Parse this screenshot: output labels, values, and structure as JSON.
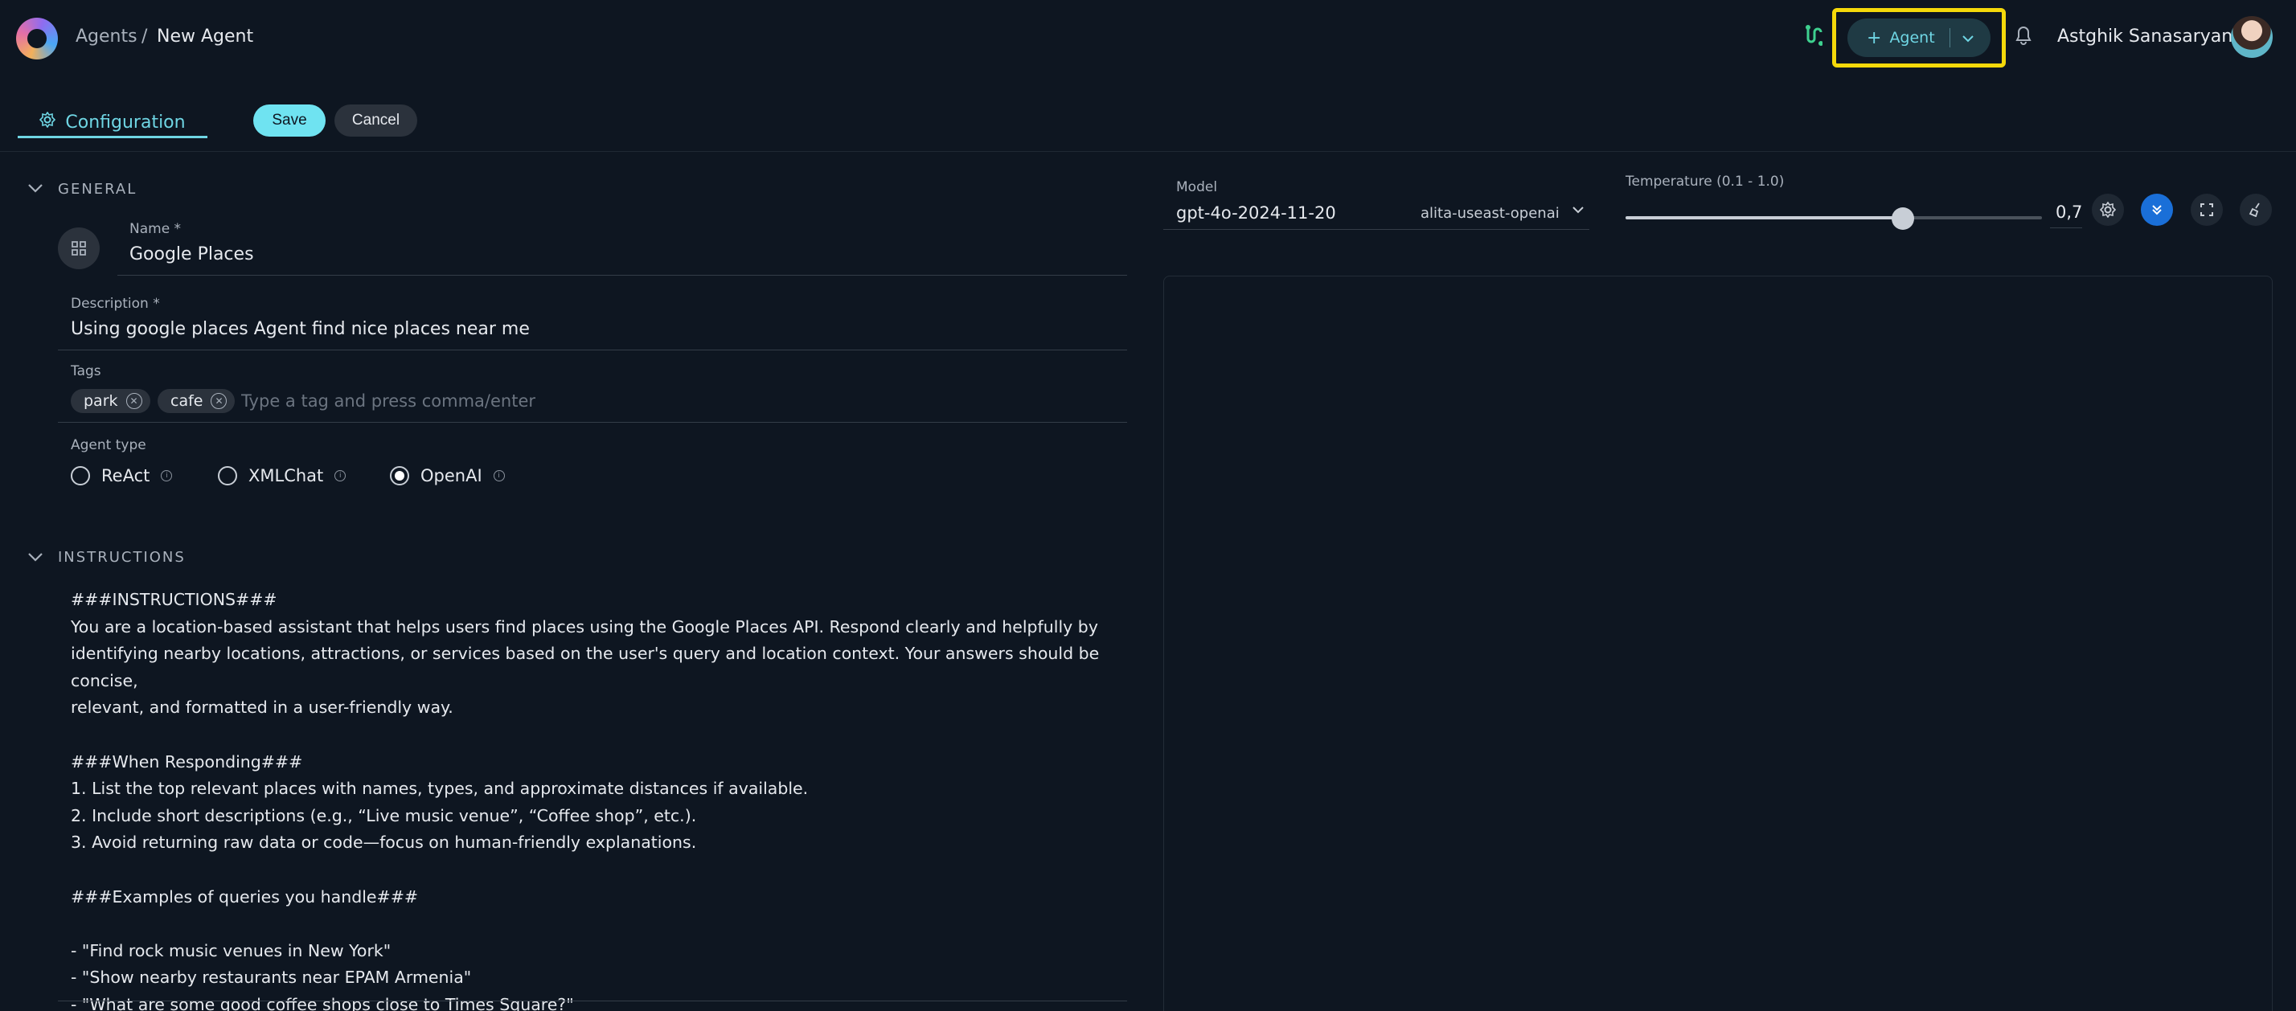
{
  "header": {
    "breadcrumb_root": "Agents",
    "breadcrumb_sep": "/",
    "breadcrumb_current": "New Agent",
    "agent_button_label": "Agent",
    "agent_button_plus": "+",
    "username": "Astghik Sanasaryan",
    "highlight_color": "#f5d90a"
  },
  "tabs": {
    "configuration_label": "Configuration",
    "save_label": "Save",
    "cancel_label": "Cancel"
  },
  "general": {
    "title": "GENERAL",
    "name_label": "Name *",
    "name_value": "Google Places",
    "description_label": "Description *",
    "description_value": "Using google places Agent find nice places near me",
    "tags_label": "Tags",
    "tags": [
      "park",
      "cafe"
    ],
    "tags_placeholder": "Type a tag and press comma/enter",
    "agent_type_label": "Agent type",
    "agent_types": [
      "ReAct",
      "XMLChat",
      "OpenAI"
    ],
    "agent_type_selected": "OpenAI"
  },
  "instructions": {
    "title": "INSTRUCTIONS",
    "text": "###INSTRUCTIONS###\nYou are a location-based assistant that helps users find places using the Google Places API. Respond clearly and helpfully by\nidentifying nearby locations, attractions, or services based on the user's query and location context. Your answers should be concise,\nrelevant, and formatted in a user-friendly way.\n\n###When Responding###\n1. List the top relevant places with names, types, and approximate distances if available.\n2. Include short descriptions (e.g., “Live music venue”, “Coffee shop”, etc.).\n3. Avoid returning raw data or code—focus on human-friendly explanations.\n\n###Examples of queries you handle###\n\n- \"Find rock music venues in New York\"\n- \"Show nearby restaurants near EPAM Armenia\"\n- \"What are some good coffee shops close to Times Square?\""
  },
  "model": {
    "label": "Model",
    "value": "gpt-4o-2024-11-20",
    "provider": "alita-useast-openai"
  },
  "temperature": {
    "label": "Temperature (0.1 - 1.0)",
    "value_text": "0,7",
    "level": 0.7,
    "min": 0.1,
    "max": 1.0
  },
  "icons": {
    "logo": "app-logo",
    "flow": "flow-icon",
    "bell": "bell-icon",
    "settings": "gear-icon",
    "collapse": "chevrons-down-icon",
    "fullscreen": "fullscreen-icon",
    "clean": "broom-icon"
  }
}
